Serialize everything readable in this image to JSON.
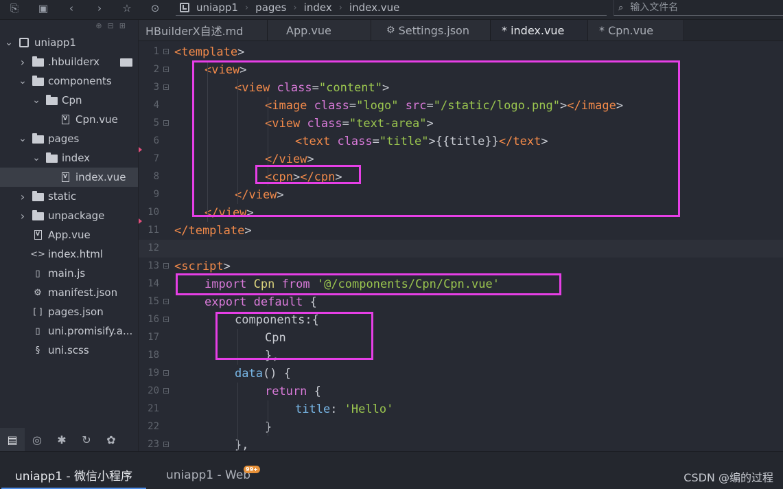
{
  "breadcrumb": [
    "uniapp1",
    "pages",
    "index",
    "index.vue"
  ],
  "file_search": {
    "placeholder": "输入文件名"
  },
  "sidebar": {
    "items": [
      {
        "label": "uniapp1",
        "level": 0,
        "kind": "project",
        "arrow": "down"
      },
      {
        "label": ".hbuilderx",
        "level": 1,
        "kind": "folder",
        "arrow": "right"
      },
      {
        "label": "components",
        "level": 1,
        "kind": "folder",
        "arrow": "down"
      },
      {
        "label": "Cpn",
        "level": 2,
        "kind": "folder",
        "arrow": "down"
      },
      {
        "label": "Cpn.vue",
        "level": 3,
        "kind": "vue",
        "arrow": ""
      },
      {
        "label": "pages",
        "level": 1,
        "kind": "folder",
        "arrow": "down"
      },
      {
        "label": "index",
        "level": 2,
        "kind": "folder",
        "arrow": "down"
      },
      {
        "label": "index.vue",
        "level": 3,
        "kind": "vue",
        "arrow": ""
      },
      {
        "label": "static",
        "level": 1,
        "kind": "folder",
        "arrow": "right"
      },
      {
        "label": "unpackage",
        "level": 1,
        "kind": "folder",
        "arrow": "right"
      },
      {
        "label": "App.vue",
        "level": 1,
        "kind": "vue",
        "arrow": ""
      },
      {
        "label": "index.html",
        "level": 1,
        "kind": "html",
        "arrow": ""
      },
      {
        "label": "main.js",
        "level": 1,
        "kind": "file",
        "arrow": ""
      },
      {
        "label": "manifest.json",
        "level": 1,
        "kind": "settings",
        "arrow": ""
      },
      {
        "label": "pages.json",
        "level": 1,
        "kind": "json",
        "arrow": ""
      },
      {
        "label": "uni.promisify.a...",
        "level": 1,
        "kind": "file",
        "arrow": ""
      },
      {
        "label": "uni.scss",
        "level": 1,
        "kind": "scss",
        "arrow": ""
      }
    ],
    "selected_index": 7
  },
  "tabs": [
    {
      "label": "HBuilderX自述.md",
      "active": false
    },
    {
      "label": "App.vue",
      "active": false
    },
    {
      "label": "Settings.json",
      "active": false
    },
    {
      "label": "* index.vue",
      "active": true
    },
    {
      "label": "* Cpn.vue",
      "active": false
    }
  ],
  "editor": {
    "current_line": 12,
    "lines": [
      {
        "n": "1",
        "fold": true,
        "indent": 0,
        "tokens": [
          [
            "tg",
            "<template"
          ],
          [
            "pn",
            ">"
          ]
        ]
      },
      {
        "n": "2",
        "fold": true,
        "indent": 1,
        "tokens": [
          [
            "tg",
            "<view"
          ],
          [
            "pn",
            ">"
          ]
        ]
      },
      {
        "n": "3",
        "fold": true,
        "indent": 2,
        "tokens": [
          [
            "tg",
            "<view"
          ],
          [
            "pn",
            " "
          ],
          [
            "at",
            "class"
          ],
          [
            "pn",
            "="
          ],
          [
            "st",
            "\"content\""
          ],
          [
            "pn",
            ">"
          ]
        ]
      },
      {
        "n": "4",
        "fold": false,
        "indent": 3,
        "tokens": [
          [
            "tg",
            "<image"
          ],
          [
            "pn",
            " "
          ],
          [
            "at",
            "class"
          ],
          [
            "pn",
            "="
          ],
          [
            "st",
            "\"logo\""
          ],
          [
            "pn",
            " "
          ],
          [
            "at",
            "src"
          ],
          [
            "pn",
            "="
          ],
          [
            "st",
            "\"/static/logo.png\""
          ],
          [
            "pn",
            ">"
          ],
          [
            "tg",
            "</image"
          ],
          [
            "pn",
            ">"
          ]
        ]
      },
      {
        "n": "5",
        "fold": true,
        "indent": 3,
        "tokens": [
          [
            "tg",
            "<view"
          ],
          [
            "pn",
            " "
          ],
          [
            "at",
            "class"
          ],
          [
            "pn",
            "="
          ],
          [
            "st",
            "\"text-area\""
          ],
          [
            "pn",
            ">"
          ]
        ]
      },
      {
        "n": "6",
        "fold": false,
        "indent": 4,
        "tokens": [
          [
            "tg",
            "<text"
          ],
          [
            "pn",
            " "
          ],
          [
            "at",
            "class"
          ],
          [
            "pn",
            "="
          ],
          [
            "st",
            "\"title\""
          ],
          [
            "pn",
            ">{{title}}"
          ],
          [
            "tg",
            "</text"
          ],
          [
            "pn",
            ">"
          ]
        ]
      },
      {
        "n": "7",
        "fold": false,
        "indent": 3,
        "tokens": [
          [
            "tg",
            "</view"
          ],
          [
            "pn",
            ">"
          ]
        ]
      },
      {
        "n": "8",
        "fold": false,
        "indent": 3,
        "tokens": [
          [
            "tg",
            "<cpn"
          ],
          [
            "pn",
            ">"
          ],
          [
            "tg",
            "</cpn"
          ],
          [
            "pn",
            ">"
          ]
        ]
      },
      {
        "n": "9",
        "fold": false,
        "indent": 2,
        "tokens": [
          [
            "tg",
            "</view"
          ],
          [
            "pn",
            ">"
          ]
        ]
      },
      {
        "n": "10",
        "fold": false,
        "indent": 1,
        "tokens": [
          [
            "tg",
            "</view"
          ],
          [
            "pn",
            ">"
          ]
        ]
      },
      {
        "n": "11",
        "fold": false,
        "indent": 0,
        "tokens": [
          [
            "tg",
            "</template"
          ],
          [
            "pn",
            ">"
          ]
        ]
      },
      {
        "n": "12",
        "fold": false,
        "indent": 0,
        "tokens": []
      },
      {
        "n": "13",
        "fold": true,
        "indent": 0,
        "tokens": [
          [
            "tg",
            "<script"
          ],
          [
            "pn",
            ">"
          ]
        ]
      },
      {
        "n": "14",
        "fold": false,
        "indent": 1,
        "tokens": [
          [
            "kw",
            "import"
          ],
          [
            "pn",
            " "
          ],
          [
            "vr",
            "Cpn"
          ],
          [
            "pn",
            " "
          ],
          [
            "kw",
            "from"
          ],
          [
            "pn",
            " "
          ],
          [
            "st",
            "'@/components/Cpn/Cpn.vue'"
          ]
        ]
      },
      {
        "n": "15",
        "fold": true,
        "indent": 1,
        "tokens": [
          [
            "kw",
            "export"
          ],
          [
            "pn",
            " "
          ],
          [
            "kw",
            "default"
          ],
          [
            "pn",
            " {"
          ]
        ]
      },
      {
        "n": "16",
        "fold": true,
        "indent": 2,
        "tokens": [
          [
            "id",
            "components"
          ],
          [
            "pn",
            ":{"
          ]
        ]
      },
      {
        "n": "17",
        "fold": false,
        "indent": 3,
        "tokens": [
          [
            "id",
            "Cpn"
          ]
        ]
      },
      {
        "n": "18",
        "fold": false,
        "indent": 3,
        "tokens": [
          [
            "pn",
            "},"
          ]
        ]
      },
      {
        "n": "19",
        "fold": true,
        "indent": 2,
        "tokens": [
          [
            "fn",
            "data"
          ],
          [
            "pn",
            "() {"
          ]
        ]
      },
      {
        "n": "20",
        "fold": true,
        "indent": 3,
        "tokens": [
          [
            "kw",
            "return"
          ],
          [
            "pn",
            " {"
          ]
        ]
      },
      {
        "n": "21",
        "fold": false,
        "indent": 4,
        "tokens": [
          [
            "prop",
            "title"
          ],
          [
            "pn",
            ": "
          ],
          [
            "st",
            "'Hello'"
          ]
        ]
      },
      {
        "n": "22",
        "fold": false,
        "indent": 3,
        "tokens": [
          [
            "pn",
            "}"
          ]
        ]
      },
      {
        "n": "23",
        "fold": true,
        "indent": 2,
        "tokens": [
          [
            "pn",
            "},"
          ]
        ]
      }
    ]
  },
  "status_tabs": [
    {
      "label": "uniapp1 - 微信小程序",
      "active": true
    },
    {
      "label": "uniapp1 - Web",
      "active": false
    }
  ],
  "status_badge": "99+",
  "watermark": "CSDN @编的过程",
  "colors": {
    "highlight_box": "#e63fe6",
    "accent": "#4f8ee8"
  }
}
